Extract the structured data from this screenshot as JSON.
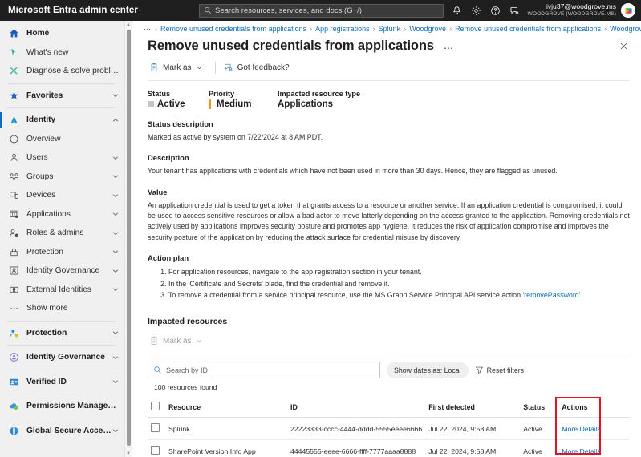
{
  "topbar": {
    "brand": "Microsoft Entra admin center",
    "search_placeholder": "Search resources, services, and docs (G+/)",
    "icons": [
      "notification-bell-icon",
      "gear-icon",
      "help-icon",
      "feedback-icon"
    ],
    "account_email": "ivju37@woodgrove.ms",
    "account_tenant": "WOODGROVE (WOODGROVE.MS)"
  },
  "sidebar": {
    "groups": [
      {
        "items": [
          {
            "label": "Home",
            "icon": "home-icon",
            "bold": true,
            "chevron": false,
            "selected": false
          },
          {
            "label": "What's new",
            "icon": "whats-new-icon",
            "bold": false,
            "chevron": false,
            "selected": false
          },
          {
            "label": "Diagnose & solve problems",
            "icon": "diagnose-icon",
            "bold": false,
            "chevron": false,
            "selected": false
          }
        ]
      },
      {
        "items": [
          {
            "label": "Favorites",
            "icon": "star-icon",
            "bold": true,
            "chevron": true,
            "selected": false
          }
        ]
      },
      {
        "items": [
          {
            "label": "Identity",
            "icon": "identity-icon",
            "bold": true,
            "chevron": true,
            "chevron_up": true,
            "selected": true
          },
          {
            "label": "Overview",
            "icon": "overview-icon",
            "bold": false,
            "chevron": false,
            "selected": false
          },
          {
            "label": "Users",
            "icon": "users-icon",
            "bold": false,
            "chevron": true,
            "selected": false
          },
          {
            "label": "Groups",
            "icon": "groups-icon",
            "bold": false,
            "chevron": true,
            "selected": false
          },
          {
            "label": "Devices",
            "icon": "devices-icon",
            "bold": false,
            "chevron": true,
            "selected": false
          },
          {
            "label": "Applications",
            "icon": "applications-icon",
            "bold": false,
            "chevron": true,
            "selected": false
          },
          {
            "label": "Roles & admins",
            "icon": "roles-admins-icon",
            "bold": false,
            "chevron": true,
            "selected": false
          },
          {
            "label": "Protection",
            "icon": "lock-icon",
            "bold": false,
            "chevron": true,
            "selected": false
          },
          {
            "label": "Identity Governance",
            "icon": "governance-icon",
            "bold": false,
            "chevron": true,
            "selected": false
          },
          {
            "label": "External Identities",
            "icon": "external-identities-icon",
            "bold": false,
            "chevron": true,
            "selected": false
          },
          {
            "label": "Show more",
            "icon": "ellipsis-icon",
            "bold": false,
            "chevron": false,
            "selected": false
          }
        ]
      },
      {
        "items": [
          {
            "label": "Protection",
            "icon": "protection-shield-icon",
            "bold": true,
            "chevron": true,
            "selected": false
          }
        ]
      },
      {
        "items": [
          {
            "label": "Identity Governance",
            "icon": "identity-governance-icon",
            "bold": true,
            "chevron": true,
            "selected": false
          }
        ]
      },
      {
        "items": [
          {
            "label": "Verified ID",
            "icon": "verified-id-icon",
            "bold": true,
            "chevron": true,
            "selected": false
          }
        ]
      },
      {
        "items": [
          {
            "label": "Permissions Management",
            "icon": "permissions-management-icon",
            "bold": true,
            "chevron": false,
            "selected": false
          }
        ]
      },
      {
        "items": [
          {
            "label": "Global Secure Access",
            "icon": "global-secure-access-icon",
            "bold": true,
            "chevron": true,
            "selected": false
          }
        ]
      }
    ]
  },
  "breadcrumb": {
    "leading": "⋯",
    "items": [
      "Remove unused credentials from applications",
      "App registrations",
      "Splunk",
      "Woodgrove",
      "Remove unused credentials from applications",
      "Woodgrove"
    ]
  },
  "page": {
    "title": "Remove unused credentials from applications",
    "more_menu": "⋯",
    "close": "✕"
  },
  "toolbar": {
    "mark_as": "Mark as",
    "got_feedback": "Got feedback?"
  },
  "kpis": {
    "status_label": "Status",
    "status_value": "Active",
    "priority_label": "Priority",
    "priority_value": "Medium",
    "priority_color": "#f7941d",
    "resource_type_label": "Impacted resource type",
    "resource_type_value": "Applications"
  },
  "sections": {
    "status_description_title": "Status description",
    "status_description_text": "Marked as active by system on 7/22/2024 at 8 AM PDT.",
    "description_title": "Description",
    "description_text": "Your tenant has applications with credentials which have not been used in more than 30 days. Hence, they are flagged as unused.",
    "value_title": "Value",
    "value_text": "An application credential is used to get a token that grants access to a resource or another service. If an application credential is compromised, it could be used to access sensitive resources or allow a bad actor to move latterly depending on the access granted to the application. Removing credentials not actively used by applications improves security posture and promotes app hygiene. It reduces the risk of application compromise and improves the security posture of the application by reducing the attack surface for credential misuse by discovery.",
    "action_plan_title": "Action plan",
    "action_plan_steps": [
      "For application resources, navigate to the app registration section in your tenant.",
      "In the 'Certificate and Secrets' blade, find the credential and remove it.",
      "To remove a credential from a service principal resource, use the MS Graph Service Principal API service action "
    ],
    "action_plan_step3_code": "'removePassword'"
  },
  "impacted": {
    "title": "Impacted resources",
    "mark_as": "Mark as",
    "search_placeholder": "Search by ID",
    "show_dates_pill": "Show dates as: Local",
    "reset_filters": "Reset filters",
    "found_text": "100 resources found",
    "columns": [
      "Resource",
      "ID",
      "First detected",
      "Status",
      "Actions"
    ],
    "rows": [
      {
        "resource": "Splunk",
        "id": "22223333-cccc-4444-dddd-5555eeee6666",
        "first_detected": "Jul 22, 2024, 9:58 AM",
        "status": "Active",
        "action": "More Details"
      },
      {
        "resource": "SharePoint Version Info App",
        "id": "44445555-eeee-6666-ffff-7777aaaa8888",
        "first_detected": "Jul 22, 2024, 9:58 AM",
        "status": "Active",
        "action": "More Details"
      }
    ],
    "highlight_color": "#e81123"
  }
}
